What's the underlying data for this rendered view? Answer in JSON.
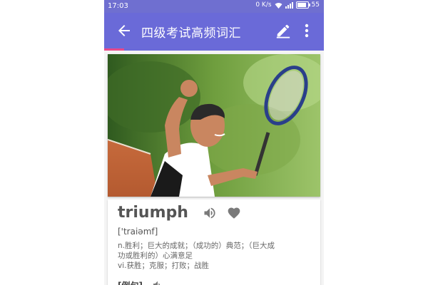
{
  "status_bar": {
    "time": "17:03",
    "network": "0 K/s",
    "battery": "55"
  },
  "app_bar": {
    "title": "四级考试高频词汇",
    "icons": [
      "back-arrow-icon",
      "edit-icon",
      "more-vert-icon"
    ]
  },
  "colors": {
    "primary": "#6a6ad8",
    "accent": "#e9498a"
  },
  "word": {
    "text": "triumph",
    "phonetic": "['traiəmf]",
    "definition_lines": [
      "n.胜利；巨大的成就；（成功的）典范；（巨大成",
      "功或胜利的）心满意足",
      "vi.获胜；克服；打败；战胜"
    ],
    "example_label": "[例句]"
  }
}
